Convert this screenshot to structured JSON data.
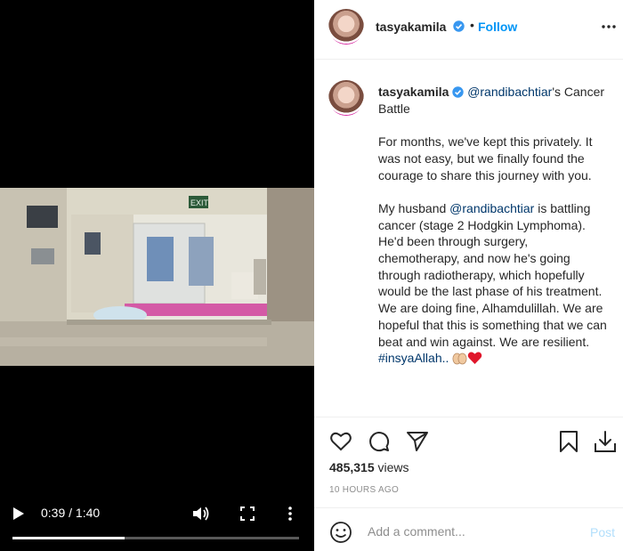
{
  "video": {
    "current_time": "0:39",
    "separator": " / ",
    "duration": "1:40",
    "progress_fraction": 0.39,
    "exit_sign": "EXIT"
  },
  "post": {
    "author": {
      "username": "tasyakamila",
      "verified": true
    },
    "follow_label": "Follow",
    "caption": {
      "mention_title": "@randibachtiar",
      "title_rest": "'s Cancer Battle",
      "para1": "For months, we've kept this privately. It was not easy, but we finally found the courage to share this journey with you.",
      "para2_prefix": "My husband ",
      "para2_mention": "@randibachtiar",
      "para2_rest": " is battling cancer (stage 2 Hodgkin Lymphoma). He'd been through surgery, chemotherapy, and now he's going through radiotherapy, which hopefully would be the last phase of his treatment. We are doing fine, Alhamdulillah. We are hopeful that this is something that we can beat and win against. We are resilient. ",
      "hashtag": "#insyaAllah..",
      "emojis": [
        "folded-hands",
        "red-heart"
      ]
    },
    "views_count": "485,315",
    "views_label": " views",
    "time_ago": "10 HOURS AGO"
  },
  "comment": {
    "placeholder": "Add a comment...",
    "post_label": "Post"
  },
  "icons": {
    "play": "play-icon",
    "volume": "volume-icon",
    "fullscreen": "fullscreen-icon",
    "more": "more-vertical-icon",
    "verified": "verified-badge-icon",
    "header_more": "more-horizontal-icon",
    "heart": "heart-icon",
    "comment": "comment-icon",
    "share": "share-icon",
    "bookmark": "bookmark-icon",
    "download": "download-icon",
    "smile": "smile-icon"
  },
  "colors": {
    "follow_blue": "#0095f6",
    "link": "#00376b",
    "muted": "#8e8e8e",
    "post_disabled": "#b2dffc",
    "heart_red": "#e0162b"
  }
}
